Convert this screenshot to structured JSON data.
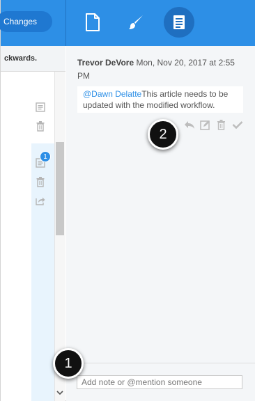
{
  "toolbar": {
    "changes_label": "Changes",
    "tools": [
      {
        "name": "document",
        "icon": "document-icon"
      },
      {
        "name": "style",
        "icon": "paintbrush-icon"
      },
      {
        "name": "notes",
        "icon": "notes-icon",
        "active": true
      }
    ]
  },
  "article": {
    "header_text": "ckwards.",
    "gutter_badge_count": "1",
    "icons": [
      "note-icon",
      "trash-icon",
      "note-icon",
      "trash-icon",
      "share-icon"
    ]
  },
  "note": {
    "author": "Trevor DeVore",
    "timestamp": "Mon, Nov 20, 2017 at 2:55 PM",
    "mention": "@Dawn Delatte",
    "text": "This article needs to be updated with the modified workflow.",
    "actions": [
      "reply-icon",
      "edit-icon",
      "trash-icon",
      "check-icon"
    ]
  },
  "composer": {
    "placeholder": "Add note or @mention someone"
  },
  "callouts": [
    "1",
    "2"
  ],
  "colors": {
    "accent": "#2d8fe6",
    "active_tool": "#1f6fc0",
    "gutter": "#e8f4fd",
    "pane": "#f4f6f8"
  }
}
